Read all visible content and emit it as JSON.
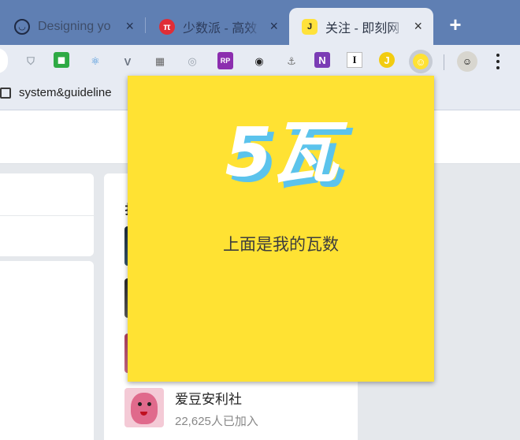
{
  "tabs": [
    {
      "title": "Designing yo",
      "favicon": "bot-face-icon"
    },
    {
      "title": "少数派 - 高效",
      "favicon": "pi-icon",
      "favicon_text": "π"
    },
    {
      "title": "关注 - 即刻网",
      "favicon": "jike-icon",
      "favicon_text": "J",
      "active": true
    }
  ],
  "tab_close_glyph": "×",
  "new_tab_glyph": "+",
  "extensions": [
    {
      "name": "shield-extension-icon",
      "glyph": "⛉",
      "color": "#9aa3ad"
    },
    {
      "name": "android-extension-icon",
      "glyph": "◼",
      "color": "#2eaa44"
    },
    {
      "name": "react-extension-icon",
      "glyph": "⚛",
      "color": "#3c8dd8"
    },
    {
      "name": "vue-extension-icon",
      "glyph": "V",
      "color": "#6b7481"
    },
    {
      "name": "image-extension-icon",
      "glyph": "▦",
      "color": "#666"
    },
    {
      "name": "target-extension-icon",
      "glyph": "◎",
      "color": "#9aa3ad"
    },
    {
      "name": "rp-extension-icon",
      "glyph": "RP",
      "color": "#8c2eaf"
    },
    {
      "name": "glasses-extension-icon",
      "glyph": "◉",
      "color": "#222"
    },
    {
      "name": "anchor-extension-icon",
      "glyph": "⚓",
      "color": "#777"
    },
    {
      "name": "onenote-extension-icon",
      "glyph": "N",
      "color": "#7b3cb5"
    },
    {
      "name": "instapaper-extension-icon",
      "glyph": "I",
      "color": "#111"
    },
    {
      "name": "jike-extension-icon",
      "glyph": "J",
      "color": "#f2cc10"
    },
    {
      "name": "wa-extension-icon",
      "glyph": "☺",
      "color": "#f5c916",
      "active": true
    }
  ],
  "avatar_glyph": "☺",
  "bookmarks": {
    "item_label": "system&guideline"
  },
  "page": {
    "topic": {
      "name": "爱豆安利社",
      "meta": "22,625人已加入"
    }
  },
  "popup": {
    "number": "5瓦",
    "caption": "上面是我的瓦数",
    "background": "#ffe233",
    "shadow_color": "#5bc3ec"
  }
}
